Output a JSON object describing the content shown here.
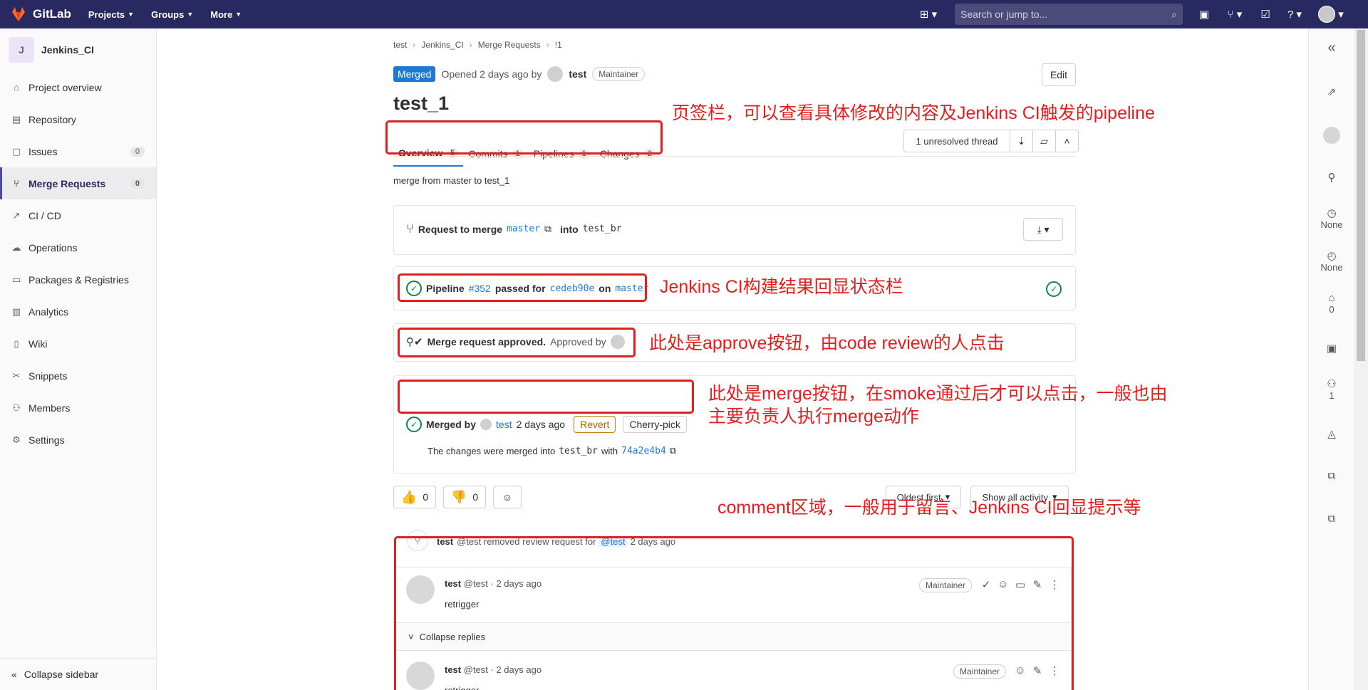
{
  "topbar": {
    "logo_text": "GitLab",
    "nav": [
      "Projects",
      "Groups",
      "More"
    ],
    "search_placeholder": "Search or jump to..."
  },
  "sidebar": {
    "project_initial": "J",
    "project_name": "Jenkins_CI",
    "items": [
      {
        "label": "Project overview",
        "icon": "home-icon"
      },
      {
        "label": "Repository",
        "icon": "book-icon"
      },
      {
        "label": "Issues",
        "icon": "issues-icon",
        "count": "0"
      },
      {
        "label": "Merge Requests",
        "icon": "merge-request-icon",
        "count": "0"
      },
      {
        "label": "CI / CD",
        "icon": "rocket-icon"
      },
      {
        "label": "Operations",
        "icon": "cloud-icon"
      },
      {
        "label": "Packages & Registries",
        "icon": "package-icon"
      },
      {
        "label": "Analytics",
        "icon": "chart-icon"
      },
      {
        "label": "Wiki",
        "icon": "book-icon"
      },
      {
        "label": "Snippets",
        "icon": "scissors-icon"
      },
      {
        "label": "Members",
        "icon": "users-icon"
      },
      {
        "label": "Settings",
        "icon": "gear-icon"
      }
    ],
    "collapse": "Collapse sidebar"
  },
  "breadcrumb": [
    "test",
    "Jenkins_CI",
    "Merge Requests",
    "!1"
  ],
  "header": {
    "status": "Merged",
    "opened": "Opened 2 days ago by",
    "author": "test",
    "role": "Maintainer",
    "edit": "Edit",
    "title": "test_1"
  },
  "tabs": [
    {
      "label": "Overview",
      "count": "5"
    },
    {
      "label": "Commits",
      "count": "1"
    },
    {
      "label": "Pipelines",
      "count": "1"
    },
    {
      "label": "Changes",
      "count": "2"
    }
  ],
  "threads": "1 unresolved thread",
  "description": "merge from master to test_1",
  "request": {
    "prefix": "Request to merge",
    "source": "master",
    "into": "into",
    "target": "test_br"
  },
  "pipeline": {
    "prefix": "Pipeline",
    "id": "#352",
    "passed": "passed for",
    "commit": "cedeb90e",
    "on": "on",
    "branch": "master"
  },
  "approval": {
    "bold": "Merge request approved.",
    "by": "Approved by"
  },
  "merged": {
    "prefix": "Merged by",
    "user": "test",
    "when": "2 days ago",
    "revert": "Revert",
    "cherry": "Cherry-pick",
    "note_prefix": "The changes were merged into",
    "target": "test_br",
    "with": "with",
    "sha": "74a2e4b4"
  },
  "reactions": {
    "up": "0",
    "down": "0"
  },
  "filters": {
    "sort": "Oldest first",
    "activity": "Show all activity"
  },
  "system_note": {
    "user": "test",
    "text": "@test removed review request for",
    "mention": "@test",
    "when": "2 days ago"
  },
  "comments": [
    {
      "author": "test",
      "meta": "@test · 2 days ago",
      "body": "retrigger",
      "role": "Maintainer"
    },
    {
      "author": "test",
      "meta": "@test · 2 days ago",
      "body": "retrigger",
      "role": "Maintainer"
    }
  ],
  "collapse_replies": "Collapse replies",
  "rsidebar": {
    "time": "None",
    "spent": "None",
    "labels": "0",
    "participants": "1"
  },
  "annotations": {
    "tabs": "页签栏，可以查看具体修改的内容及Jenkins CI触发的pipeline",
    "pipeline": "Jenkins CI构建结果回显状态栏",
    "approve": "此处是approve按钮，由code review的人点击",
    "merge_line1": "此处是merge按钮，在smoke通过后才可以点击，一般也由",
    "merge_line2": "主要负责人执行merge动作",
    "comment": "comment区域，一般用于留言、Jenkins CI回显提示等"
  },
  "colors": {
    "nav_bg": "#292961",
    "accent": "#1f78d1",
    "success": "#108548",
    "annotation": "#e02020"
  }
}
